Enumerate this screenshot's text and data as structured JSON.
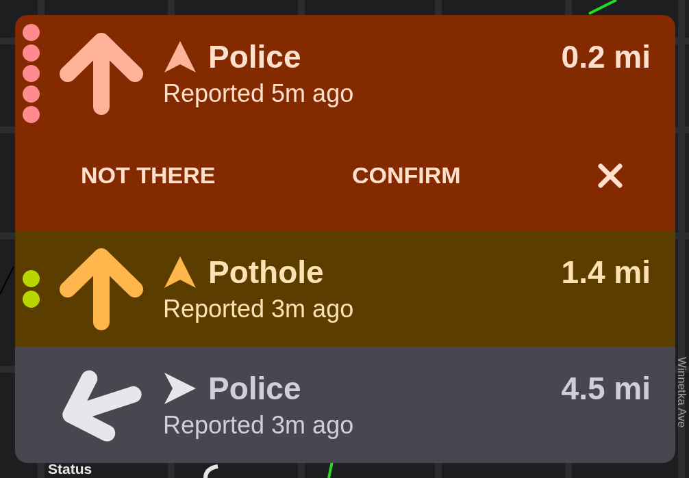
{
  "map": {
    "street": "Winnetka Ave",
    "label": "Status"
  },
  "alerts": [
    {
      "title": "Police",
      "distance": "0.2 mi",
      "reported": "Reported 5m ago",
      "kind": "straight",
      "color": "#832a00",
      "expanded": true,
      "dots": [
        {
          "color": "#ff8a8f"
        },
        {
          "color": "#ff8a8f"
        },
        {
          "color": "#ff8a8f"
        },
        {
          "color": "#ff8a8f"
        },
        {
          "color": "#ff8a8f"
        }
      ],
      "actions": [
        {
          "kind": "text",
          "label": "NOT THERE"
        },
        {
          "kind": "text",
          "label": "CONFIRM"
        },
        {
          "kind": "close"
        }
      ]
    },
    {
      "title": "Pothole",
      "distance": "1.4 mi",
      "reported": "Reported 3m ago",
      "kind": "straight",
      "color": "#5c3d00",
      "expanded": false,
      "dots": [
        {
          "color": "#b8d600"
        },
        {
          "color": "#b8d600"
        }
      ]
    },
    {
      "title": "Police",
      "distance": "4.5 mi",
      "reported": "Reported 3m ago",
      "kind": "left",
      "color": "#48464f",
      "expanded": false
    }
  ]
}
